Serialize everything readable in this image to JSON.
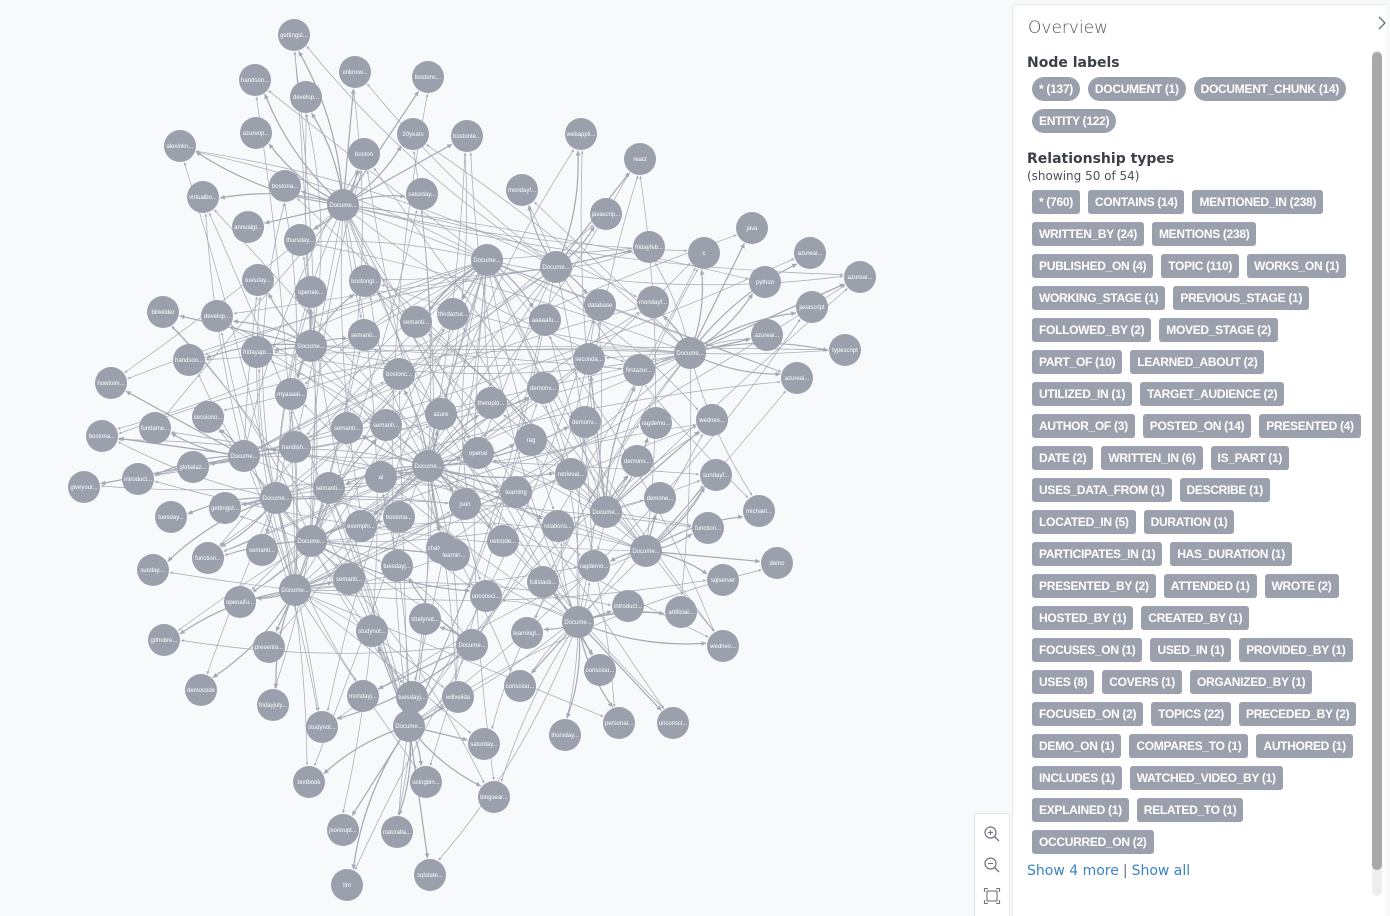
{
  "panel": {
    "title": "Overview",
    "collapse_icon": "chevron-right-icon",
    "node_labels_title": "Node labels",
    "node_labels": [
      {
        "label": "* (137)"
      },
      {
        "label": "DOCUMENT (1)"
      },
      {
        "label": "DOCUMENT_CHUNK (14)"
      },
      {
        "label": "ENTITY (122)"
      }
    ],
    "relationship_types_title": "Relationship types",
    "relationship_types_subtitle": "(showing 50 of 54)",
    "relationship_types": [
      {
        "label": "* (760)"
      },
      {
        "label": "CONTAINS (14)"
      },
      {
        "label": "MENTIONED_IN (238)"
      },
      {
        "label": "WRITTEN_BY (24)"
      },
      {
        "label": "MENTIONS (238)"
      },
      {
        "label": "PUBLISHED_ON (4)"
      },
      {
        "label": "TOPIC (110)"
      },
      {
        "label": "WORKS_ON (1)"
      },
      {
        "label": "WORKING_STAGE (1)"
      },
      {
        "label": "PREVIOUS_STAGE (1)"
      },
      {
        "label": "FOLLOWED_BY (2)"
      },
      {
        "label": "MOVED_STAGE (2)"
      },
      {
        "label": "PART_OF (10)"
      },
      {
        "label": "LEARNED_ABOUT (2)"
      },
      {
        "label": "UTILIZED_IN (1)"
      },
      {
        "label": "TARGET_AUDIENCE (2)"
      },
      {
        "label": "AUTHOR_OF (3)"
      },
      {
        "label": "POSTED_ON (14)"
      },
      {
        "label": "PRESENTED (4)"
      },
      {
        "label": "DATE (2)"
      },
      {
        "label": "WRITTEN_IN (6)"
      },
      {
        "label": "IS_PART (1)"
      },
      {
        "label": "USES_DATA_FROM (1)"
      },
      {
        "label": "DESCRIBE (1)"
      },
      {
        "label": "LOCATED_IN (5)"
      },
      {
        "label": "DURATION (1)"
      },
      {
        "label": "PARTICIPATES_IN (1)"
      },
      {
        "label": "HAS_DURATION (1)"
      },
      {
        "label": "PRESENTED_BY (2)"
      },
      {
        "label": "ATTENDED (1)"
      },
      {
        "label": "WROTE (2)"
      },
      {
        "label": "HOSTED_BY (1)"
      },
      {
        "label": "CREATED_BY (1)"
      },
      {
        "label": "FOCUSES_ON (1)"
      },
      {
        "label": "USED_IN (1)"
      },
      {
        "label": "PROVIDED_BY (1)"
      },
      {
        "label": "USES (8)"
      },
      {
        "label": "COVERS (1)"
      },
      {
        "label": "ORGANIZED_BY (1)"
      },
      {
        "label": "FOCUSED_ON (2)"
      },
      {
        "label": "TOPICS (22)"
      },
      {
        "label": "PRECEDED_BY (2)"
      },
      {
        "label": "DEMO_ON (1)"
      },
      {
        "label": "COMPARES_TO (1)"
      },
      {
        "label": "AUTHORED (1)"
      },
      {
        "label": "INCLUDES (1)"
      },
      {
        "label": "WATCHED_VIDEO_BY (1)"
      },
      {
        "label": "EXPLAINED (1)"
      },
      {
        "label": "RELATED_TO (1)"
      },
      {
        "label": "OCCURRED_ON (2)"
      }
    ],
    "show_more_label": "Show 4 more",
    "separator": "|",
    "show_all_label": "Show all"
  },
  "zoom_controls": {
    "zoom_in_icon": "zoom-in-icon",
    "zoom_out_icon": "zoom-out-icon",
    "fit_icon": "fit-to-screen-icon"
  },
  "graph": {
    "node_color": "#9ba0ad",
    "edge_color": "#a4a8b2",
    "hubs": [
      {
        "id": "h1",
        "label": "Docume..."
      },
      {
        "id": "h2",
        "label": "Docume..."
      },
      {
        "id": "h3",
        "label": "Docume..."
      },
      {
        "id": "h4",
        "label": "Docume..."
      },
      {
        "id": "h5",
        "label": "Docume..."
      },
      {
        "id": "h6",
        "label": "Docume..."
      },
      {
        "id": "h7",
        "label": "Docume..."
      },
      {
        "id": "h8",
        "label": "Docume..."
      },
      {
        "id": "h9",
        "label": "Docume..."
      },
      {
        "id": "h10",
        "label": "Docume..."
      },
      {
        "id": "h11",
        "label": "Docume..."
      },
      {
        "id": "h12",
        "label": "Docume..."
      },
      {
        "id": "h13",
        "label": "Docume..."
      },
      {
        "id": "h14",
        "label": "Docume..."
      },
      {
        "id": "h15",
        "label": "Docume..."
      }
    ],
    "nodes": [
      {
        "label": "gettingst...",
        "hub": "h1"
      },
      {
        "label": "unknow...",
        "hub": "h1"
      },
      {
        "label": "handson...",
        "hub": "h1"
      },
      {
        "label": "develop...",
        "hub": "h1"
      },
      {
        "label": "bostonc...",
        "hub": "h1"
      },
      {
        "label": "azureop...",
        "hub": "h1"
      },
      {
        "label": "20years",
        "hub": "h1"
      },
      {
        "label": "bostonte...",
        "hub": "h1"
      },
      {
        "label": "alexinkn...",
        "hub": "h1"
      },
      {
        "label": "boston",
        "hub": "h1"
      },
      {
        "label": "bostona...",
        "hub": "h1"
      },
      {
        "label": "saturday...",
        "hub": "h1"
      },
      {
        "label": "virtualbo...",
        "hub": "h1"
      },
      {
        "label": "annualgl...",
        "hub": "h1"
      },
      {
        "label": "thursday...",
        "hub": "h1"
      },
      {
        "label": "webappli...",
        "hub": "h3"
      },
      {
        "label": "react",
        "hub": "h3"
      },
      {
        "label": "mondayf...",
        "hub": "h3"
      },
      {
        "label": "javascrip...",
        "hub": "h3"
      },
      {
        "label": "fridayfeb...",
        "hub": "h3"
      },
      {
        "label": "database",
        "hub": "h3"
      },
      {
        "label": "c",
        "hub": "h4"
      },
      {
        "label": "java",
        "hub": "h4"
      },
      {
        "label": "azureai...",
        "hub": "h4"
      },
      {
        "label": "python",
        "hub": "h4"
      },
      {
        "label": "azureai...",
        "hub": "h4"
      },
      {
        "label": "javascript",
        "hub": "h4"
      },
      {
        "label": "mondayf...",
        "hub": "h4"
      },
      {
        "label": "azureai...",
        "hub": "h4"
      },
      {
        "label": "typescript",
        "hub": "h4"
      },
      {
        "label": "azureai...",
        "hub": "h4"
      },
      {
        "label": "billwilder",
        "hub": "h5"
      },
      {
        "label": "tuesday...",
        "hub": "h5"
      },
      {
        "label": "develop...",
        "hub": "h5"
      },
      {
        "label": "openaic...",
        "hub": "h5"
      },
      {
        "label": "bostongl...",
        "hub": "h5"
      },
      {
        "label": "handson...",
        "hub": "h5"
      },
      {
        "label": "fridayapr...",
        "hub": "h5"
      },
      {
        "label": "semanti...",
        "hub": "h5"
      },
      {
        "label": "semanti...",
        "hub": "h2"
      },
      {
        "label": "thirdaztur...",
        "hub": "h2"
      },
      {
        "label": "aaaaafo...",
        "hub": "h2"
      },
      {
        "label": "myaaaai...",
        "hub": "h5"
      },
      {
        "label": "howtoim...",
        "hub": "h6"
      },
      {
        "label": "fundame...",
        "hub": "h6"
      },
      {
        "label": "sessiono...",
        "hub": "h6"
      },
      {
        "label": "bostona...",
        "hub": "h6"
      },
      {
        "label": "globalaz...",
        "hub": "h6"
      },
      {
        "label": "introduct...",
        "hub": "h6"
      },
      {
        "label": "giveyour...",
        "hub": "h6"
      },
      {
        "label": "handish...",
        "hub": "h6"
      },
      {
        "label": "tuesday...",
        "hub": "h7"
      },
      {
        "label": "gettingst...",
        "hub": "h7"
      },
      {
        "label": "function...",
        "hub": "h7"
      },
      {
        "label": "sunday....",
        "hub": "h7"
      },
      {
        "label": "semanti...",
        "hub": "h7"
      },
      {
        "label": "ai",
        "hub": "h8"
      },
      {
        "label": "azure",
        "hub": "h8"
      },
      {
        "label": "openai",
        "hub": "h8"
      },
      {
        "label": "json",
        "hub": "h8"
      },
      {
        "label": "rag",
        "hub": "h8"
      },
      {
        "label": "learning",
        "hub": "h8"
      },
      {
        "label": "thereplo...",
        "hub": "h8"
      },
      {
        "label": "semanti...",
        "hub": "h8"
      },
      {
        "label": "exemphi...",
        "hub": "h8"
      },
      {
        "label": "semanti...",
        "hub": "h8"
      },
      {
        "label": "bostonc...",
        "hub": "h8"
      },
      {
        "label": "chatcopil...",
        "hub": "h8"
      },
      {
        "label": "netcode...",
        "hub": "h8"
      },
      {
        "label": "retrieval...",
        "hub": "h8"
      },
      {
        "label": "relations...",
        "hub": "h8"
      },
      {
        "label": "demonv...",
        "hub": "h8"
      },
      {
        "label": "demonv...",
        "hub": "h8"
      },
      {
        "label": "seconda...",
        "hub": "h9"
      },
      {
        "label": "firstazur...",
        "hub": "h9"
      },
      {
        "label": "ragdemo...",
        "hub": "h9"
      },
      {
        "label": "wednes...",
        "hub": "h9"
      },
      {
        "label": "demonv...",
        "hub": "h9"
      },
      {
        "label": "sundayf...",
        "hub": "h10"
      },
      {
        "label": "demone...",
        "hub": "h10"
      },
      {
        "label": "michael...",
        "hub": "h10"
      },
      {
        "label": "function...",
        "hub": "h10"
      },
      {
        "label": "demo",
        "hub": "h10"
      },
      {
        "label": "sqlserver",
        "hub": "h10"
      },
      {
        "label": "ragdemo...",
        "hub": "h10"
      },
      {
        "label": "introduct...",
        "hub": "h11"
      },
      {
        "label": "artificial...",
        "hub": "h11"
      },
      {
        "label": "wednes...",
        "hub": "h11"
      },
      {
        "label": "fullstack...",
        "hub": "h11"
      },
      {
        "label": "learningl...",
        "hub": "h11"
      },
      {
        "label": "consciou...",
        "hub": "h11"
      },
      {
        "label": "consciou...",
        "hub": "h11"
      },
      {
        "label": "thursday...",
        "hub": "h11"
      },
      {
        "label": "personal...",
        "hub": "h11"
      },
      {
        "label": "unconsci...",
        "hub": "h11"
      },
      {
        "label": "openaifu...",
        "hub": "h12"
      },
      {
        "label": "githubre...",
        "hub": "h12"
      },
      {
        "label": "presenta...",
        "hub": "h12"
      },
      {
        "label": "democode",
        "hub": "h12"
      },
      {
        "label": "fridayjuly...",
        "hub": "h12"
      },
      {
        "label": "semanti...",
        "hub": "h12"
      },
      {
        "label": "tuesdayj...",
        "hub": "h13"
      },
      {
        "label": "studynot...",
        "hub": "h13"
      },
      {
        "label": "mondayj...",
        "hub": "h13"
      },
      {
        "label": "studynot...",
        "hub": "h13"
      },
      {
        "label": "textbook",
        "hub": "h14"
      },
      {
        "label": "studynot...",
        "hub": "h14"
      },
      {
        "label": "tuesdayj...",
        "hub": "h14"
      },
      {
        "label": "willvelida",
        "hub": "h14"
      },
      {
        "label": "saturday...",
        "hub": "h14"
      },
      {
        "label": "usingbin...",
        "hub": "h14"
      },
      {
        "label": "bingsear...",
        "hub": "h14"
      },
      {
        "label": "jsonoupt...",
        "hub": "h14"
      },
      {
        "label": "naturalla...",
        "hub": "h14"
      },
      {
        "label": "llm",
        "hub": "h14"
      },
      {
        "label": "sqlstate...",
        "hub": "h14"
      },
      {
        "label": "bostona...",
        "hub": "h15"
      },
      {
        "label": "unconsci...",
        "hub": "h15"
      },
      {
        "label": "learnin...",
        "hub": "h15"
      },
      {
        "label": "semanti...",
        "hub": "h15"
      }
    ]
  }
}
